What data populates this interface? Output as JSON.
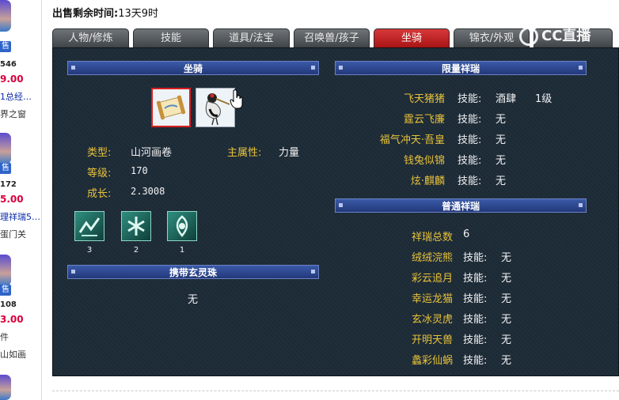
{
  "left_listing": [
    {
      "num": "546",
      "price": "9.00",
      "desc": "1总经…",
      "desc2": "界之窗"
    },
    {
      "num": "172",
      "price": "5.00",
      "desc": "理祥瑞5…",
      "desc2": "蛋门关"
    },
    {
      "num": "108",
      "price": "3.00",
      "desc": "件",
      "desc2": "山如画"
    }
  ],
  "sell_badge": "售",
  "header": {
    "label": "出售剩余时间:",
    "value": "13天9时"
  },
  "tabs": [
    "人物/修炼",
    "技能",
    "道具/法宝",
    "召唤兽/孩子",
    "坐骑",
    "锦衣/外观"
  ],
  "active_tab": "坐骑",
  "watermark": "CC直播",
  "mount": {
    "title": "坐骑",
    "icon_names": [
      "scroll-mount-icon",
      "crane-mount-icon"
    ],
    "type_label": "类型:",
    "type_value": "山河画卷",
    "attr_label": "主属性:",
    "attr_value": "力量",
    "level_label": "等级:",
    "level_value": "170",
    "growth_label": "成长:",
    "growth_value": "2.3008",
    "skills": [
      {
        "count": "3"
      },
      {
        "count": "2"
      },
      {
        "count": "1"
      }
    ]
  },
  "spirit": {
    "title": "携带玄灵珠",
    "value": "无"
  },
  "limited": {
    "title": "限量祥瑞",
    "items": [
      {
        "name": "飞天猪猪",
        "skill_label": "技能:",
        "skill": "酒肆",
        "level": "1级"
      },
      {
        "name": "霆云飞廉",
        "skill_label": "技能:",
        "skill": "无",
        "level": ""
      },
      {
        "name": "福气冲天·吾皇",
        "skill_label": "技能:",
        "skill": "无",
        "level": ""
      },
      {
        "name": "钱兔似锦",
        "skill_label": "技能:",
        "skill": "无",
        "level": ""
      },
      {
        "name": "炫·麒麟",
        "skill_label": "技能:",
        "skill": "无",
        "level": ""
      }
    ]
  },
  "normal": {
    "title": "普通祥瑞",
    "total_label": "祥瑞总数",
    "total_value": "6",
    "items": [
      {
        "name": "绒绒浣熊",
        "skill_label": "技能:",
        "skill": "无"
      },
      {
        "name": "彩云追月",
        "skill_label": "技能:",
        "skill": "无"
      },
      {
        "name": "幸运龙猫",
        "skill_label": "技能:",
        "skill": "无"
      },
      {
        "name": "玄冰灵虎",
        "skill_label": "技能:",
        "skill": "无"
      },
      {
        "name": "开明天兽",
        "skill_label": "技能:",
        "skill": "无"
      },
      {
        "name": "蠡彩仙蜗",
        "skill_label": "技能:",
        "skill": "无"
      }
    ]
  },
  "colors": {
    "label_gold": "#e8c23a",
    "panel_bg": "#1c2a36",
    "active_tab": "#c41e1e",
    "price": "#d8003c"
  }
}
